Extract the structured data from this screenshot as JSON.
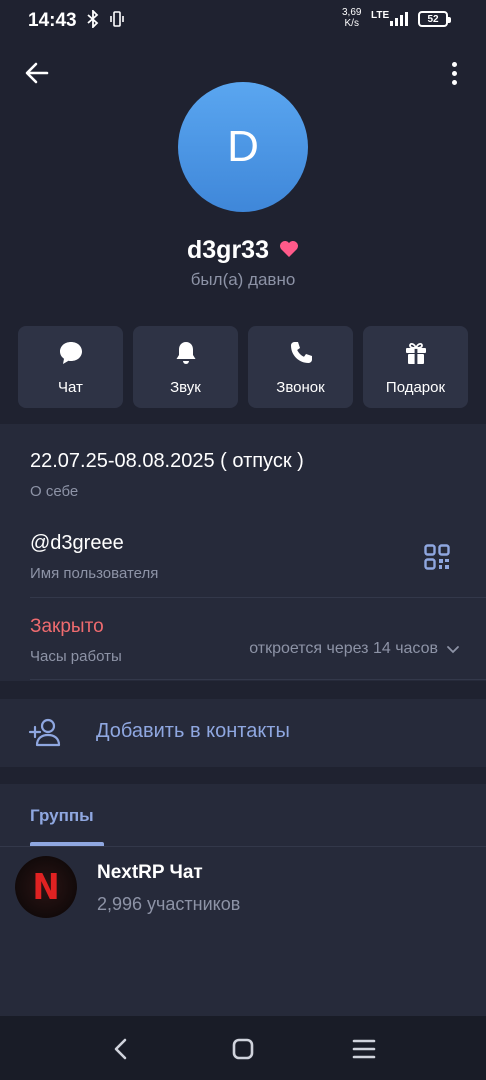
{
  "status_bar": {
    "time": "14:43",
    "speed_value": "3,69",
    "speed_unit": "K/s",
    "network": "LTE",
    "battery": "52"
  },
  "profile": {
    "avatar_letter": "D",
    "name": "d3gr33",
    "status": "был(а) давно"
  },
  "actions": [
    {
      "label": "Чат",
      "icon": "chat-icon"
    },
    {
      "label": "Звук",
      "icon": "bell-icon"
    },
    {
      "label": "Звонок",
      "icon": "phone-icon"
    },
    {
      "label": "Подарок",
      "icon": "gift-icon"
    }
  ],
  "info": {
    "bio": "22.07.25-08.08.2025 ( отпуск )",
    "bio_label": "О себе",
    "username": "@d3greee",
    "username_label": "Имя пользователя",
    "hours_status": "Закрыто",
    "hours_label": "Часы работы",
    "hours_detail": "откроется через 14 часов"
  },
  "add_contact": {
    "label": "Добавить в контакты"
  },
  "groups": {
    "tab_label": "Группы",
    "items": [
      {
        "avatar_letter": "N",
        "name": "NextRP Чат",
        "members": "2,996 участников"
      }
    ]
  },
  "colors": {
    "background": "#1f2230",
    "card": "#262a3a",
    "accent": "#8fa7e0",
    "closed": "#ef6b6f",
    "avatar": "#4a96e6"
  }
}
